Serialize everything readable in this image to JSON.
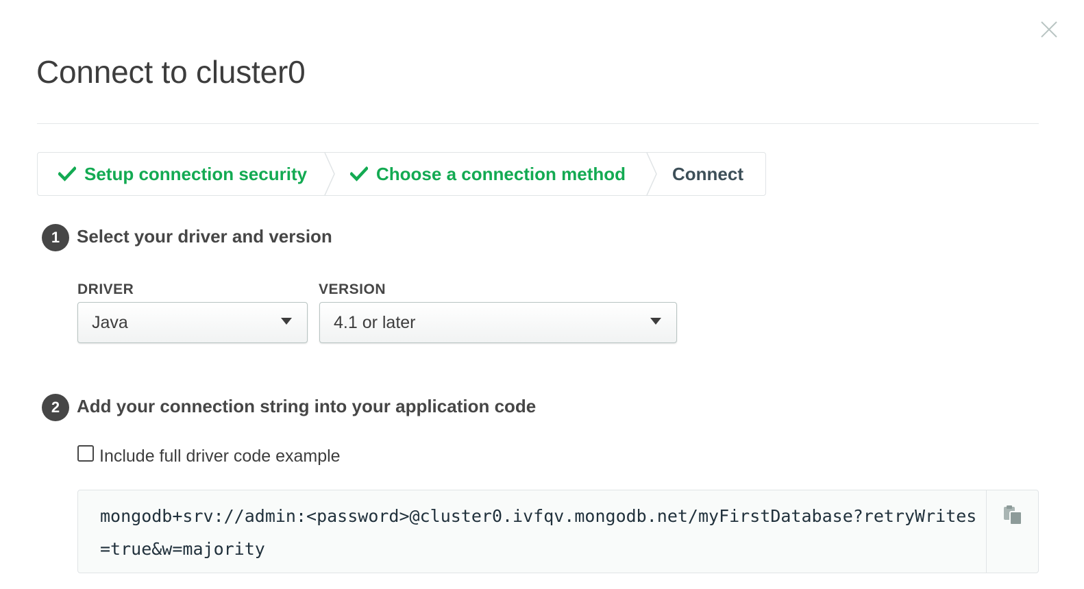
{
  "modal": {
    "title": "Connect to cluster0"
  },
  "stepper": {
    "steps": [
      {
        "label": "Setup connection security",
        "status": "done"
      },
      {
        "label": "Choose a connection method",
        "status": "done"
      },
      {
        "label": "Connect",
        "status": "active"
      }
    ]
  },
  "section1": {
    "number": "1",
    "heading": "Select your driver and version",
    "driver": {
      "label": "DRIVER",
      "value": "Java"
    },
    "version": {
      "label": "VERSION",
      "value": "4.1 or later"
    }
  },
  "section2": {
    "number": "2",
    "heading": "Add your connection string into your application code",
    "checkbox": {
      "label": "Include full driver code example",
      "checked": false
    },
    "connection_string": "mongodb+srv://admin:<password>@cluster0.ivfqv.mongodb.net/myFirstDatabase?retryWrites=true&w=majority"
  },
  "colors": {
    "success": "#13aa52",
    "text_dark": "#464646",
    "border": "#e0e4e6"
  },
  "icons": [
    "close-icon",
    "check-icon",
    "chevron-right-icon",
    "copy-icon",
    "caret-down-icon"
  ]
}
